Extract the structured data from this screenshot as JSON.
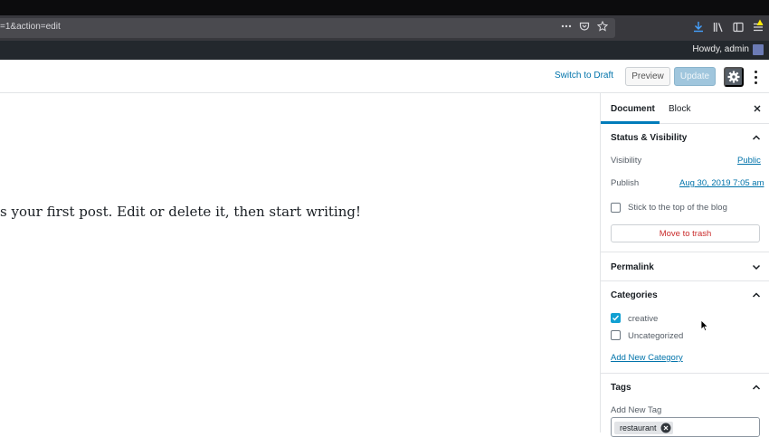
{
  "browser": {
    "url": "=1&action=edit"
  },
  "admin_bar": {
    "howdy": "Howdy, admin"
  },
  "header": {
    "switch_to_draft": "Switch to Draft",
    "preview": "Preview",
    "update": "Update"
  },
  "content": {
    "paragraph": "s your first post. Edit or delete it, then start writing!"
  },
  "sidebar": {
    "tabs": [
      {
        "label": "Document",
        "active": true
      },
      {
        "label": "Block",
        "active": false
      }
    ],
    "status": {
      "title": "Status & Visibility",
      "visibility_label": "Visibility",
      "visibility_value": "Public",
      "publish_label": "Publish",
      "publish_value": "Aug 30, 2019 7:05 am",
      "sticky_label": "Stick to the top of the blog",
      "trash": "Move to trash"
    },
    "permalink": {
      "title": "Permalink"
    },
    "categories": {
      "title": "Categories",
      "items": [
        {
          "label": "creative",
          "checked": true
        },
        {
          "label": "Uncategorized",
          "checked": false
        }
      ],
      "add_new": "Add New Category"
    },
    "tags": {
      "title": "Tags",
      "add_label": "Add New Tag",
      "chips": [
        "restaurant"
      ]
    }
  },
  "colors": {
    "accent": "#007cba",
    "link": "#0073aa",
    "danger": "#c92c2c",
    "admin_bar": "#23282d"
  }
}
